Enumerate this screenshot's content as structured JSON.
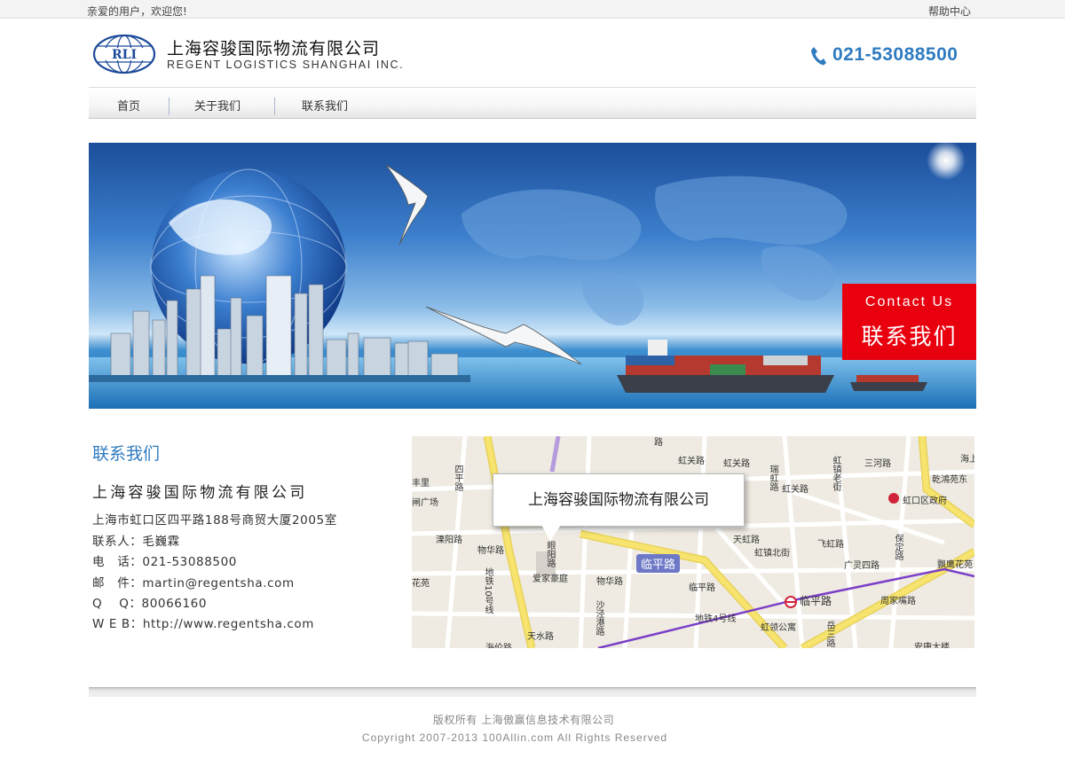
{
  "topbar": {
    "greeting": "亲爱的用户，欢迎您!",
    "help": "帮助中心"
  },
  "header": {
    "logo_text": "RLI",
    "company_cn": "上海容骏国际物流有限公司",
    "company_en": "REGENT LOGISTICS SHANGHAI INC.",
    "phone": "021-53088500",
    "phone_icon": "phone-icon"
  },
  "nav": {
    "items": [
      {
        "label": "首页"
      },
      {
        "label": "关于我们"
      },
      {
        "label": "联系我们"
      }
    ]
  },
  "banner": {
    "contact_en": "Contact Us",
    "contact_cn": "联系我们"
  },
  "contact": {
    "title": "联系我们",
    "company": "上海容骏国际物流有限公司",
    "address": "上海市虹口区四平路188号商贸大厦2005室",
    "person": "联系人：毛巍霖",
    "phone": "电　话：021-53088500",
    "email": "邮　件：martin@regentsha.com",
    "qq": "Q　 Q：80066160",
    "web": "W E B：http://www.regentsha.com"
  },
  "map": {
    "callout": "上海容骏国际物流有限公司",
    "badge": "临平路",
    "labels": {
      "l1": "路",
      "l2": "虹关路",
      "l3": "虹关路",
      "l4": "瑞虹路",
      "l5": "虹关路",
      "l6": "虹镇老街",
      "l7": "三河路",
      "l8": "海上",
      "l9": "乾鴻苑东",
      "l10": "虹口区政府",
      "l11": "丰里",
      "l12": "闸广场",
      "l13": "四平路",
      "l14": "溧阳路",
      "l15": "物华路",
      "l16": "眼阳路",
      "l17": "天虹路",
      "l18": "虹镇北街",
      "l19": "飞虹路",
      "l20": "保定路",
      "l21": "飘鹰花苑",
      "l22": "广灵四路",
      "l23": "花苑",
      "l24": "爱家豪庭",
      "l25": "物华路",
      "l26": "沙泾港路",
      "l27": "临平路",
      "l28": "临平路",
      "l29": "周家嘴路",
      "l30": "地铁4号线",
      "l31": "虹领公寓",
      "l32": "岳三路",
      "l33": "安康大楼",
      "l34": "海伦路",
      "l35": "天水路",
      "l36": "地铁10号线"
    }
  },
  "footer": {
    "copyright_cn": "版权所有 上海傲赢信息技术有限公司",
    "copyright_en": "Copyright 2007-2013 100Allin.com All Rights Reserved"
  },
  "colors": {
    "brand_blue": "#2f7bc0",
    "contact_red": "#e8000e",
    "metro_purple": "#7b3fc8",
    "road_yellow": "#f6e46e"
  }
}
